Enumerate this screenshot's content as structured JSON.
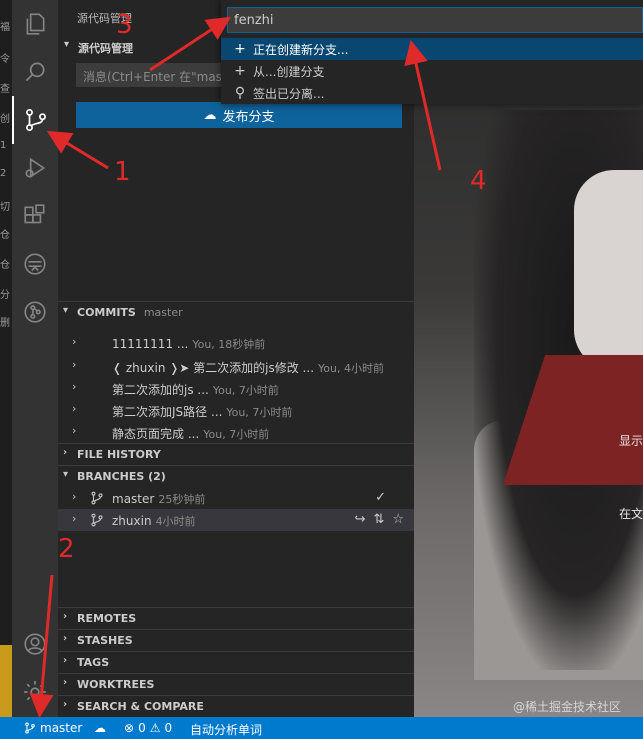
{
  "left_strip": {
    "chars": [
      "福",
      "令",
      "查",
      "创",
      "1",
      "2",
      "切",
      "仓",
      "仓",
      "分",
      "删"
    ]
  },
  "activity_bar": {
    "items": [
      {
        "name": "explorer-icon"
      },
      {
        "name": "search-icon"
      },
      {
        "name": "source-control-icon",
        "active": true
      },
      {
        "name": "run-debug-icon"
      },
      {
        "name": "extensions-icon"
      },
      {
        "name": "remote-explorer-icon"
      },
      {
        "name": "gitlens-icon"
      }
    ],
    "bottom": [
      {
        "name": "account-icon"
      },
      {
        "name": "settings-gear-icon"
      }
    ]
  },
  "sidebar": {
    "title": "源代码管理",
    "scm_section": "源代码管理",
    "message_placeholder": "消息(Ctrl+Enter 在\"master\"提交)",
    "publish_label": "发布分支",
    "commits": {
      "header": "COMMITS",
      "branch": "master",
      "rows": [
        {
          "label": "11111111 ...",
          "desc": "You, 18秒钟前"
        },
        {
          "label": "❬ zhuxin ❭➤ 第二次添加的js修改 ...",
          "desc": "You, 4小时前"
        },
        {
          "label": "第二次添加的js ...",
          "desc": "You, 7小时前"
        },
        {
          "label": "第二次添加JS路径 ...",
          "desc": "You, 7小时前"
        },
        {
          "label": "静态页面完成 ...",
          "desc": "You, 7小时前"
        }
      ]
    },
    "file_history": "FILE HISTORY",
    "branches": {
      "header": "BRANCHES (2)",
      "rows": [
        {
          "name": "master",
          "desc": "25秒钟前",
          "check": "✓"
        },
        {
          "name": "zhuxin",
          "desc": "4小时前"
        }
      ]
    },
    "bottom_sections": [
      "REMOTES",
      "STASHES",
      "TAGS",
      "WORKTREES",
      "SEARCH & COMPARE"
    ]
  },
  "quick_input": {
    "value": "fenzhi",
    "items": [
      {
        "icon": "plus",
        "label": "正在创建新分支..."
      },
      {
        "icon": "plus",
        "label": "从...创建分支"
      },
      {
        "icon": "detach",
        "label": "签出已分离..."
      }
    ]
  },
  "editor": {
    "peek_texts": [
      "显示",
      "在文"
    ],
    "watermark": "@稀土掘金技术社区"
  },
  "statusbar": {
    "branch": "master",
    "errors": "0",
    "warnings": "0",
    "extra": "自动分析单词"
  },
  "annotations": {
    "labels": [
      "1",
      "2",
      "3",
      "4"
    ],
    "color": "#e02a2a"
  }
}
